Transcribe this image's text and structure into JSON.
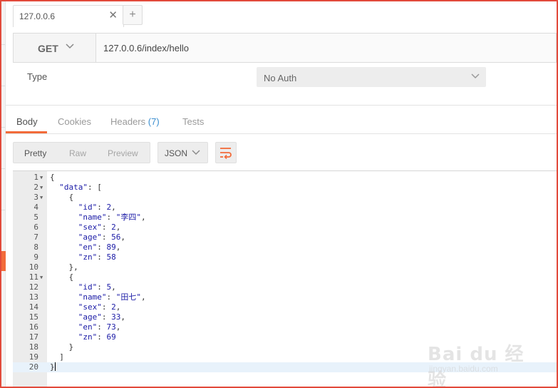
{
  "tabs": [
    {
      "title": "127.0.0.6",
      "close_glyph": "✕"
    }
  ],
  "new_tab_glyph": "+",
  "request": {
    "method": "GET",
    "url": "127.0.0.6/index/hello"
  },
  "auth": {
    "label": "Type",
    "value": "No Auth"
  },
  "response_tabs": [
    {
      "label": "Body",
      "active": true
    },
    {
      "label": "Cookies",
      "active": false
    },
    {
      "label": "Headers",
      "count": "(7)",
      "active": false
    },
    {
      "label": "Tests",
      "active": false
    }
  ],
  "view_modes": [
    "Pretty",
    "Raw",
    "Preview"
  ],
  "active_view": "Pretty",
  "format": "JSON",
  "colors": {
    "accent": "#f26b3a",
    "link": "#3b8ecf",
    "frame": "#e24a3b"
  },
  "code_lines": [
    {
      "n": "1",
      "fold": true,
      "tokens": [
        [
          "p",
          "{"
        ]
      ]
    },
    {
      "n": "2",
      "fold": true,
      "tokens": [
        [
          "p",
          "  "
        ],
        [
          "k",
          "\"data\""
        ],
        [
          "p",
          ": ["
        ]
      ]
    },
    {
      "n": "3",
      "fold": true,
      "tokens": [
        [
          "p",
          "    {"
        ]
      ]
    },
    {
      "n": "4",
      "fold": false,
      "tokens": [
        [
          "p",
          "      "
        ],
        [
          "k",
          "\"id\""
        ],
        [
          "p",
          ": "
        ],
        [
          "n",
          "2"
        ],
        [
          "p",
          ","
        ]
      ]
    },
    {
      "n": "5",
      "fold": false,
      "tokens": [
        [
          "p",
          "      "
        ],
        [
          "k",
          "\"name\""
        ],
        [
          "p",
          ": "
        ],
        [
          "s",
          "\"李四\""
        ],
        [
          "p",
          ","
        ]
      ]
    },
    {
      "n": "6",
      "fold": false,
      "tokens": [
        [
          "p",
          "      "
        ],
        [
          "k",
          "\"sex\""
        ],
        [
          "p",
          ": "
        ],
        [
          "n",
          "2"
        ],
        [
          "p",
          ","
        ]
      ]
    },
    {
      "n": "7",
      "fold": false,
      "tokens": [
        [
          "p",
          "      "
        ],
        [
          "k",
          "\"age\""
        ],
        [
          "p",
          ": "
        ],
        [
          "n",
          "56"
        ],
        [
          "p",
          ","
        ]
      ]
    },
    {
      "n": "8",
      "fold": false,
      "tokens": [
        [
          "p",
          "      "
        ],
        [
          "k",
          "\"en\""
        ],
        [
          "p",
          ": "
        ],
        [
          "n",
          "89"
        ],
        [
          "p",
          ","
        ]
      ]
    },
    {
      "n": "9",
      "fold": false,
      "tokens": [
        [
          "p",
          "      "
        ],
        [
          "k",
          "\"zn\""
        ],
        [
          "p",
          ": "
        ],
        [
          "n",
          "58"
        ]
      ]
    },
    {
      "n": "10",
      "fold": false,
      "tokens": [
        [
          "p",
          "    },"
        ]
      ]
    },
    {
      "n": "11",
      "fold": true,
      "tokens": [
        [
          "p",
          "    {"
        ]
      ]
    },
    {
      "n": "12",
      "fold": false,
      "tokens": [
        [
          "p",
          "      "
        ],
        [
          "k",
          "\"id\""
        ],
        [
          "p",
          ": "
        ],
        [
          "n",
          "5"
        ],
        [
          "p",
          ","
        ]
      ]
    },
    {
      "n": "13",
      "fold": false,
      "tokens": [
        [
          "p",
          "      "
        ],
        [
          "k",
          "\"name\""
        ],
        [
          "p",
          ": "
        ],
        [
          "s",
          "\"田七\""
        ],
        [
          "p",
          ","
        ]
      ]
    },
    {
      "n": "14",
      "fold": false,
      "tokens": [
        [
          "p",
          "      "
        ],
        [
          "k",
          "\"sex\""
        ],
        [
          "p",
          ": "
        ],
        [
          "n",
          "2"
        ],
        [
          "p",
          ","
        ]
      ]
    },
    {
      "n": "15",
      "fold": false,
      "tokens": [
        [
          "p",
          "      "
        ],
        [
          "k",
          "\"age\""
        ],
        [
          "p",
          ": "
        ],
        [
          "n",
          "33"
        ],
        [
          "p",
          ","
        ]
      ]
    },
    {
      "n": "16",
      "fold": false,
      "tokens": [
        [
          "p",
          "      "
        ],
        [
          "k",
          "\"en\""
        ],
        [
          "p",
          ": "
        ],
        [
          "n",
          "73"
        ],
        [
          "p",
          ","
        ]
      ]
    },
    {
      "n": "17",
      "fold": false,
      "tokens": [
        [
          "p",
          "      "
        ],
        [
          "k",
          "\"zn\""
        ],
        [
          "p",
          ": "
        ],
        [
          "n",
          "69"
        ]
      ]
    },
    {
      "n": "18",
      "fold": false,
      "tokens": [
        [
          "p",
          "    }"
        ]
      ]
    },
    {
      "n": "19",
      "fold": false,
      "tokens": [
        [
          "p",
          "  ]"
        ]
      ]
    },
    {
      "n": "20",
      "fold": false,
      "current": true,
      "tokens": [
        [
          "p",
          "}"
        ]
      ]
    }
  ],
  "watermark": {
    "brand": "Bai du 经验",
    "site": "jingyan.baidu.com"
  }
}
